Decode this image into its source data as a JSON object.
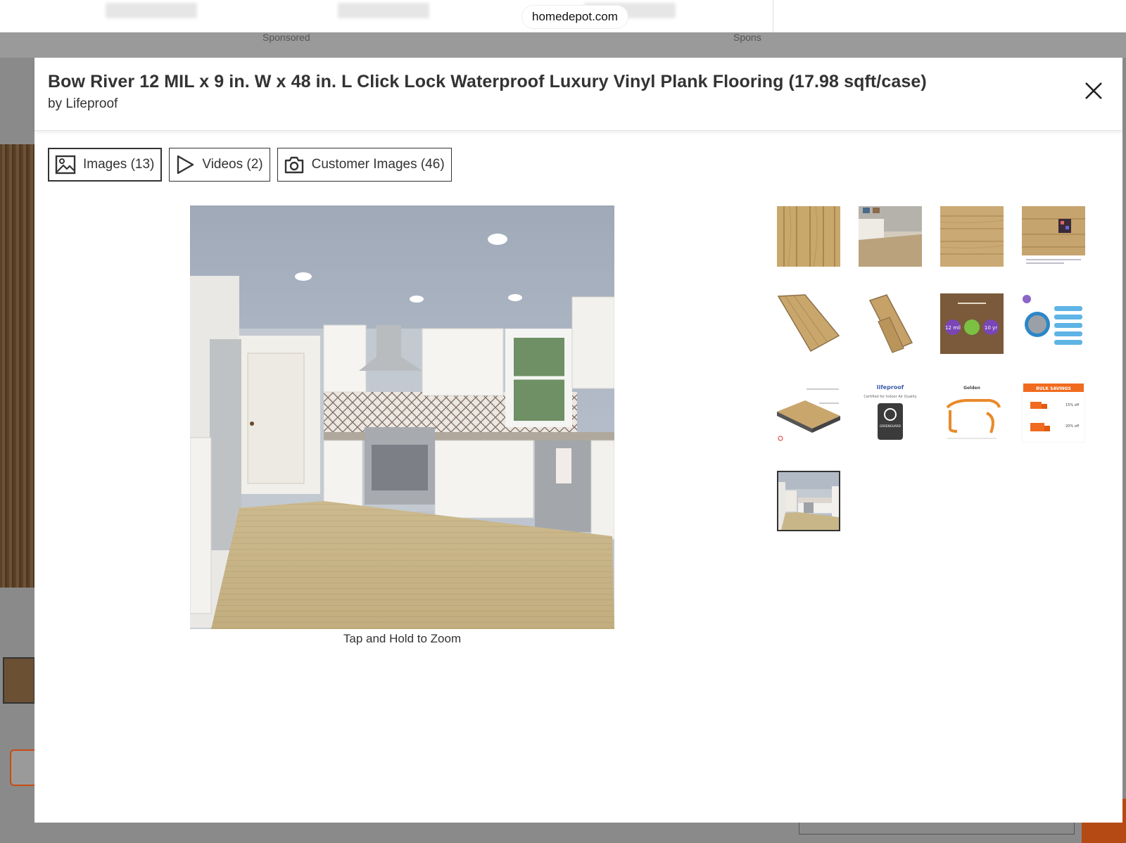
{
  "browser": {
    "url": "homedepot.com"
  },
  "background": {
    "sponsored_left": "Sponsored",
    "sponsored_right": "Spons"
  },
  "modal": {
    "title": "Bow River 12 MIL x 9 in. W x 48 in. L Click Lock Waterproof Luxury Vinyl Plank Flooring (17.98 sqft/case)",
    "brand": "by Lifeproof",
    "close_icon": "close-icon",
    "tabs": [
      {
        "label": "Images (13)",
        "icon": "image-icon",
        "active": true
      },
      {
        "label": "Videos (2)",
        "icon": "play-icon",
        "active": false
      },
      {
        "label": "Customer Images (46)",
        "icon": "camera-icon",
        "active": false
      }
    ],
    "zoom_hint": "Tap and Hold to Zoom",
    "thumbnails": [
      {
        "label": "Wood plank texture close-up"
      },
      {
        "label": "Living room with flooring"
      },
      {
        "label": "Wood grain swatch"
      },
      {
        "label": "Swatch with sample info"
      },
      {
        "label": "Single plank angled"
      },
      {
        "label": "Two planks"
      },
      {
        "label": "Feature badges infographic",
        "badge_left": "12 mil",
        "badge_right": "10 yr"
      },
      {
        "label": "Features list infographic"
      },
      {
        "label": "Layer construction diagram"
      },
      {
        "label": "Lifeproof certification",
        "brand": "lifeproof",
        "sub": "Certified for Indoor Air Quality",
        "badge": "GREENGUARD"
      },
      {
        "label": "Moulding profiles",
        "title": "Golden"
      },
      {
        "label": "Bulk savings",
        "header": "BULK SAVINGS",
        "tier1": "15% off",
        "tier2": "20% off"
      },
      {
        "label": "Kitchen scene",
        "selected": true
      }
    ],
    "selected_index": 13
  }
}
